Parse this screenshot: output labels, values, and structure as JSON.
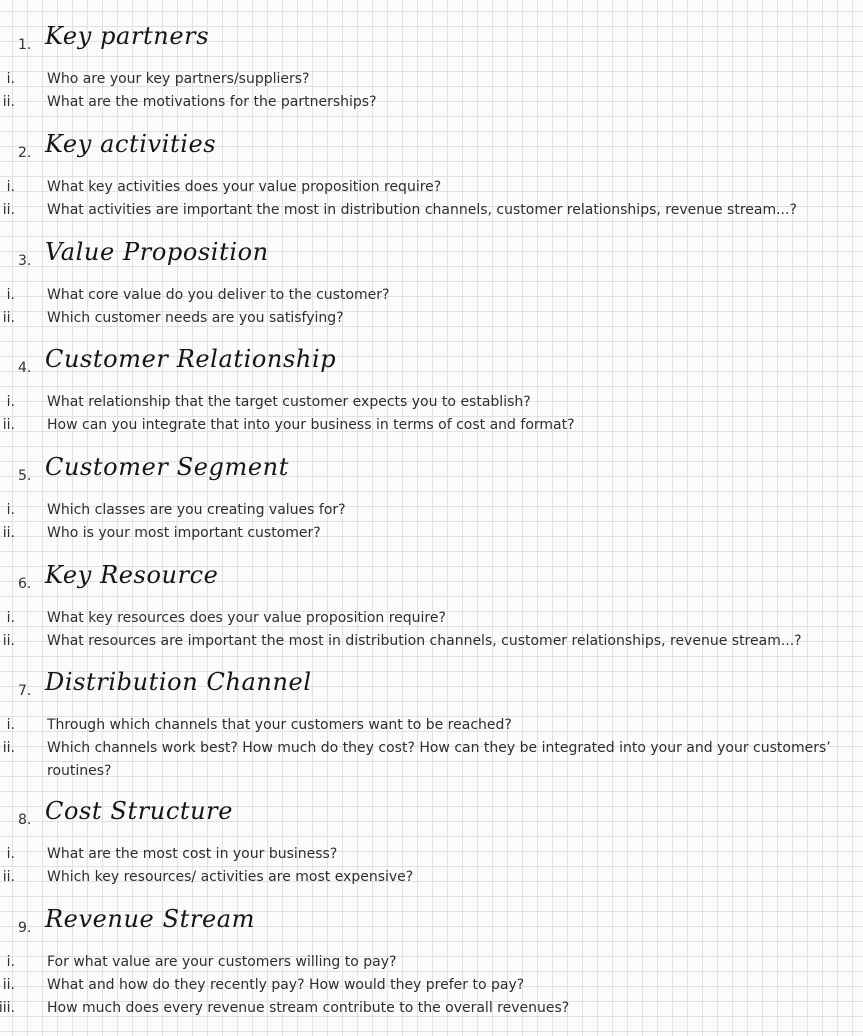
{
  "sections": [
    {
      "number": "1.",
      "title": "Key partners",
      "questions": [
        {
          "numeral": "i.",
          "text": "Who are your key partners/suppliers?"
        },
        {
          "numeral": "ii.",
          "text": "What are the motivations for the partnerships?"
        }
      ]
    },
    {
      "number": "2.",
      "title": "Key activities",
      "questions": [
        {
          "numeral": "i.",
          "text": "What key activities does your value proposition require?"
        },
        {
          "numeral": "ii.",
          "text": "What activities are important the most in distribution channels, customer relationships, revenue stream...?"
        }
      ]
    },
    {
      "number": "3.",
      "title": "Value Proposition",
      "questions": [
        {
          "numeral": "i.",
          "text": "What core value do you deliver to the customer?"
        },
        {
          "numeral": "ii.",
          "text": "Which customer needs are you satisfying?"
        }
      ]
    },
    {
      "number": "4.",
      "title": "Customer Relationship",
      "questions": [
        {
          "numeral": "i.",
          "text": "What relationship that the target customer expects you to establish?"
        },
        {
          "numeral": "ii.",
          "text": "How can you integrate that into your business in terms of cost and format?"
        }
      ]
    },
    {
      "number": "5.",
      "title": "Customer Segment",
      "questions": [
        {
          "numeral": "i.",
          "text": "Which classes are you creating values for?"
        },
        {
          "numeral": "ii.",
          "text": "Who is your most important customer?"
        }
      ]
    },
    {
      "number": "6.",
      "title": "Key Resource",
      "questions": [
        {
          "numeral": "i.",
          "text": "What key resources does your value proposition require?"
        },
        {
          "numeral": "ii.",
          "text": "What resources are important the most in distribution channels, customer relationships, revenue stream...?"
        }
      ]
    },
    {
      "number": "7.",
      "title": "Distribution Channel",
      "questions": [
        {
          "numeral": "i.",
          "text": "Through which channels that your customers want to be reached?"
        },
        {
          "numeral": "ii.",
          "text": "Which channels work best? How much do they cost? How can they be integrated into your and your customers’"
        },
        {
          "numeral": "",
          "text": "routines?"
        }
      ]
    },
    {
      "number": "8.",
      "title": "Cost Structure",
      "questions": [
        {
          "numeral": "i.",
          "text": "What are the most cost in your business?"
        },
        {
          "numeral": "ii.",
          "text": "Which key resources/ activities are most expensive?"
        }
      ]
    },
    {
      "number": "9.",
      "title": "Revenue Stream",
      "questions": [
        {
          "numeral": "i.",
          "text": "For what value are your customers willing to pay?"
        },
        {
          "numeral": "ii.",
          "text": "What and how do they recently pay? How would they prefer to pay?"
        },
        {
          "numeral": "iii.",
          "text": "How much does every revenue stream contribute to the overall revenues?"
        }
      ]
    }
  ]
}
